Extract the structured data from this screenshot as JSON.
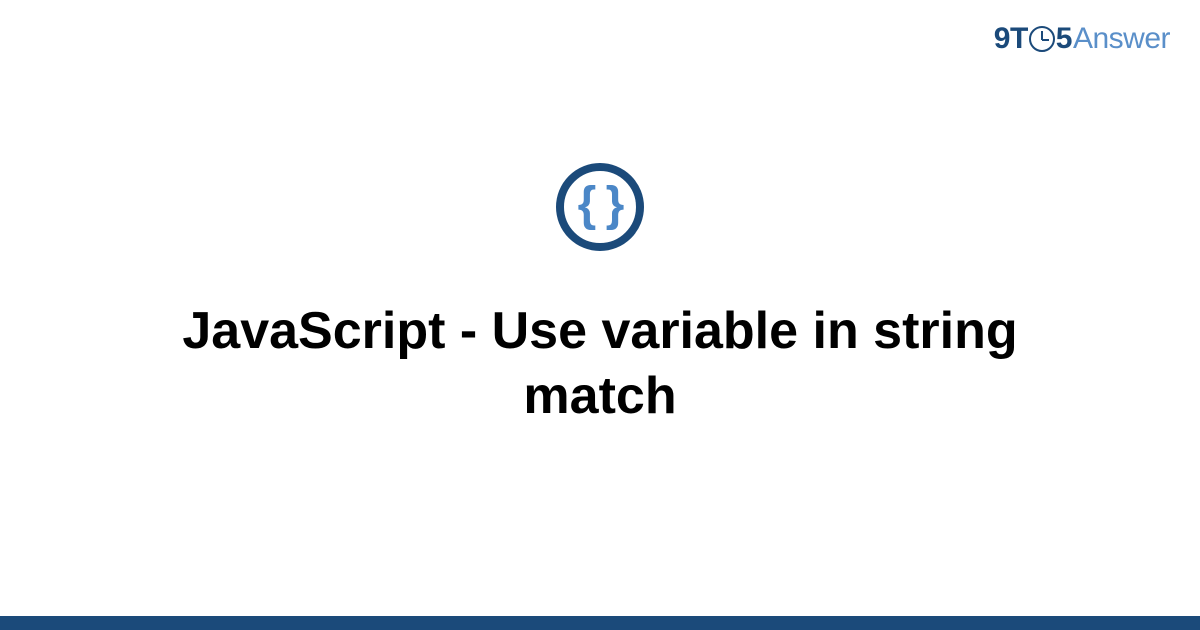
{
  "brand": {
    "segment_nine": "9",
    "segment_t": "T",
    "segment_five": "5",
    "segment_answer": "Answer"
  },
  "icon": {
    "name": "code-braces-icon",
    "glyph": "{ }"
  },
  "title": "JavaScript - Use variable in string match",
  "colors": {
    "primary_dark": "#1b4a7a",
    "primary_light": "#5a8fc9",
    "brace_blue": "#4b87c7"
  }
}
